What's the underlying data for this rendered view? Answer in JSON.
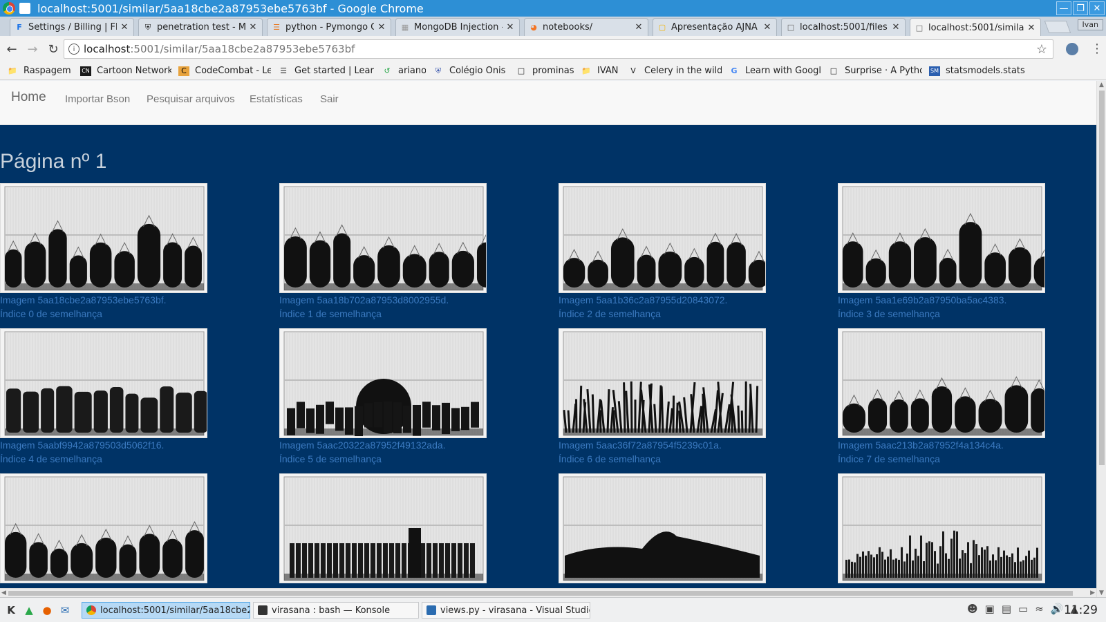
{
  "window": {
    "title": "localhost:5001/similar/5aa18cbe2a87953ebe5763bf - Google Chrome"
  },
  "tabs": [
    {
      "label": "Settings / Billing | Flo",
      "icon": "f-icon"
    },
    {
      "label": "penetration test - Mo",
      "icon": "shield-icon"
    },
    {
      "label": "python - Pymongo O",
      "icon": "stack-icon"
    },
    {
      "label": "MongoDB Injection - ",
      "icon": "grid-icon"
    },
    {
      "label": "notebooks/",
      "icon": "jupyter-icon"
    },
    {
      "label": "Apresentação AJNA",
      "icon": "slides-icon"
    },
    {
      "label": "localhost:5001/files",
      "icon": "page-icon"
    },
    {
      "label": "localhost:5001/similar",
      "icon": "page-icon",
      "active": true
    }
  ],
  "profile": "Ivan",
  "address": {
    "host": "localhost",
    "path": ":5001/similar/5aa18cbe2a87953ebe5763bf"
  },
  "bookmarks": [
    {
      "label": "Raspagem",
      "icon": "folder-icon"
    },
    {
      "label": "Cartoon Network",
      "icon": "cn-icon"
    },
    {
      "label": "CodeCombat - Lea",
      "icon": "codecombat-icon"
    },
    {
      "label": "Get started | Lear",
      "icon": "bars-icon"
    },
    {
      "label": "ariano",
      "icon": "g-icon"
    },
    {
      "label": "Colégio Onis",
      "icon": "shield-icon"
    },
    {
      "label": "prominas",
      "icon": "page-icon"
    },
    {
      "label": "IVAN",
      "icon": "folder-icon"
    },
    {
      "label": "Celery in the wild:",
      "icon": "v-icon"
    },
    {
      "label": "Learn with Google",
      "icon": "google-icon"
    },
    {
      "label": "Surprise · A Pytho",
      "icon": "page-icon"
    },
    {
      "label": "statsmodels.stats",
      "icon": "sm-icon"
    }
  ],
  "nav": {
    "brand": "Home",
    "links": [
      "Importar Bson",
      "Pesquisar arquivos",
      "Estatísticas",
      "Sair"
    ]
  },
  "page_title": "Página nº 1",
  "results": [
    {
      "image": "Imagem 5aa18cbe2a87953ebe5763bf.",
      "index": "Índice 0 de semelhança"
    },
    {
      "image": "Imagem 5aa18b702a87953d8002955d.",
      "index": "Índice 1 de semelhança"
    },
    {
      "image": "Imagem 5aa1b36c2a87955d20843072.",
      "index": "Índice 2 de semelhança"
    },
    {
      "image": "Imagem 5aa1e69b2a87950ba5ac4383.",
      "index": "Índice 3 de semelhança"
    },
    {
      "image": "Imagem 5aabf9942a879503d5062f16.",
      "index": "Índice 4 de semelhança"
    },
    {
      "image": "Imagem 5aac20322a87952f49132ada.",
      "index": "Índice 5 de semelhança"
    },
    {
      "image": "Imagem 5aac36f72a87954f5239c01a.",
      "index": "Índice 6 de semelhança"
    },
    {
      "image": "Imagem 5aac213b2a87952f4a134c4a.",
      "index": "Índice 7 de semelhança"
    },
    {
      "image": "",
      "index": ""
    },
    {
      "image": "",
      "index": ""
    },
    {
      "image": "",
      "index": ""
    },
    {
      "image": "",
      "index": ""
    }
  ],
  "taskbar": {
    "tasks": [
      {
        "label": "localhost:5001/similar/5aa18cbe2a",
        "icon": "chrome-icon",
        "active": true
      },
      {
        "label": "virasana : bash — Konsole",
        "icon": "terminal-icon"
      },
      {
        "label": "views.py - virasana - Visual Studio C",
        "icon": "vscode-icon"
      }
    ],
    "clock": "11:29"
  }
}
